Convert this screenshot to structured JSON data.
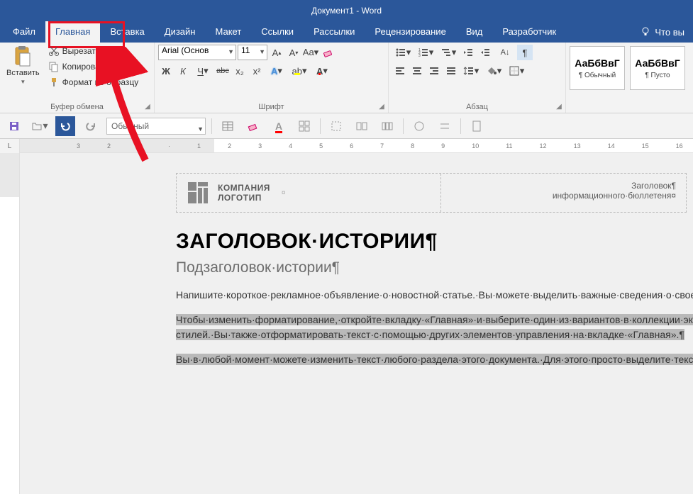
{
  "title": "Документ1 - Word",
  "menutabs": [
    "Файл",
    "Главная",
    "Вставка",
    "Дизайн",
    "Макет",
    "Ссылки",
    "Рассылки",
    "Рецензирование",
    "Вид",
    "Разработчик"
  ],
  "activeTab": 1,
  "help": "Что вы",
  "clipboard": {
    "paste": "Вставить",
    "cut": "Вырезать",
    "copy": "Копировать",
    "format": "Формат по образцу",
    "label": "Буфер обмена"
  },
  "font": {
    "name": "Arial (Основ",
    "size": "11",
    "label": "Шрифт",
    "bold": "Ж",
    "italic": "К",
    "underline": "Ч",
    "strike": "abc",
    "sub": "x₂",
    "sup": "x²"
  },
  "para": {
    "label": "Абзац"
  },
  "styles": {
    "sample": "АаБбВвГ",
    "s1": "¶ Обычный",
    "s2": "¶ Пусто"
  },
  "qat": {
    "combo": "Обычный"
  },
  "doc": {
    "logo1": "КОМПАНИЯ",
    "logo2": "ЛОГОТИП",
    "hdr1": "Заголовок¶",
    "hdr2": "информационного·бюллетеня¤",
    "title": "ЗАГОЛОВОК·ИСТОРИИ¶",
    "subtitle": "Подзаголовок·истории¶",
    "p1": "Напишите·короткое·рекламное·объявление·о·новостной·статье.·Вы·можете·выделить·важные·сведения·о·своей·компании,·о·которых·расскажете·ниже.¶",
    "p2": "Чтобы·изменить·форматирование,·откройте·вкладку·«Главная»·и·выберите·один·из·вариантов·в·коллекции·экспресс-стилей.·Вы·также·отформатировать·текст·с·помощью·других·элементов·управления·на·вкладке·«Главная».¶",
    "p3": "Вы·в·любой·момент·можете·изменить·текст·любого·раздела·этого·документа.·Для·этого·просто·выделите·текст·и·начните·печатать.·Этот·шаблон·предварительно·подготовлен,·поэтому·для·новой·введенной·информации·форматирование·сохраняется.¶"
  },
  "ruler": {
    "corner": "L"
  }
}
